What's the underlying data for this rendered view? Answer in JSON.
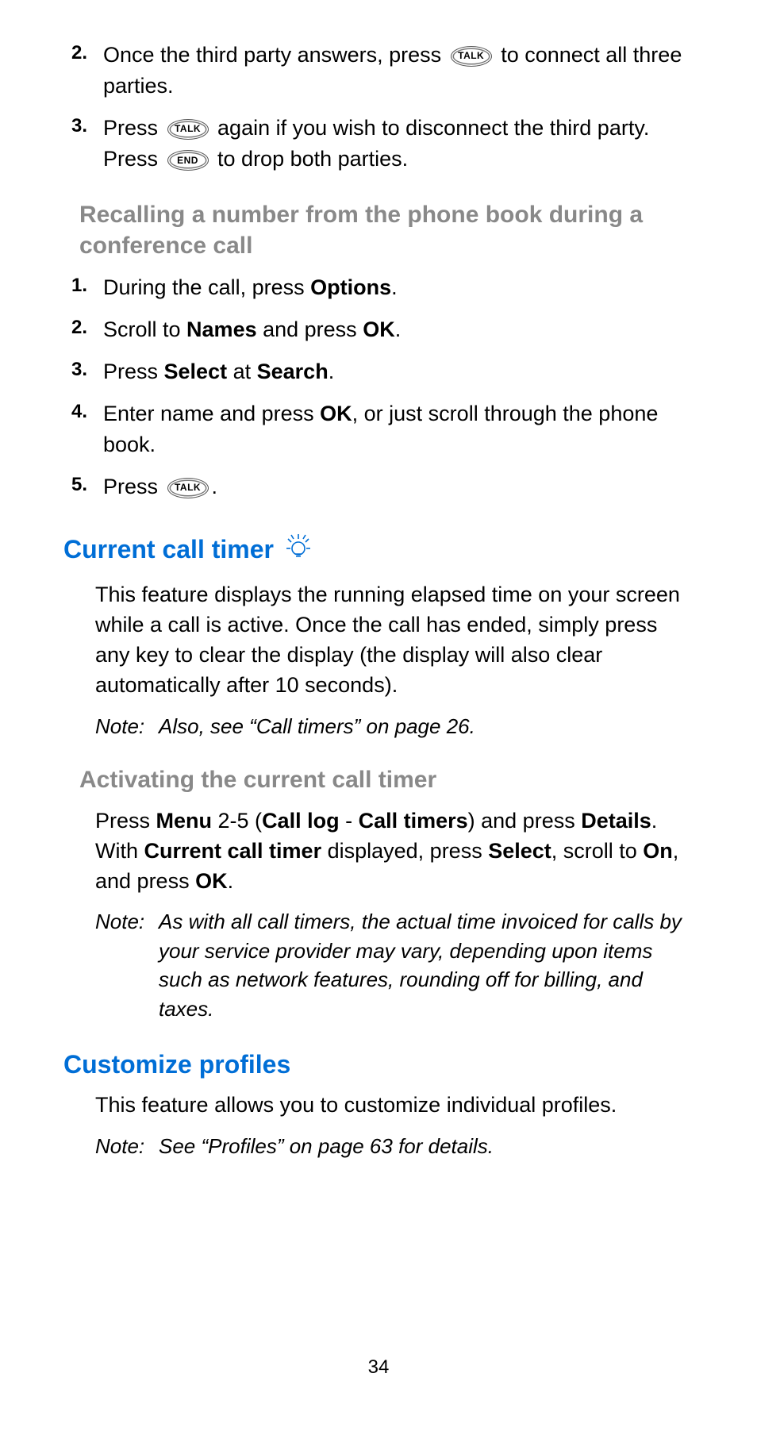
{
  "top_steps": [
    {
      "n": "2.",
      "pre": "Once the third party answers, press ",
      "key": "TALK",
      "post": " to connect all three parties."
    },
    {
      "n": "3.",
      "pre": "Press ",
      "key": "TALK",
      "mid": " again if you wish to disconnect the third party. Press ",
      "key2": "END",
      "post": " to drop both parties."
    }
  ],
  "recall": {
    "heading": "Recalling a number from the phone book during a conference call",
    "steps": {
      "s1": {
        "n": "1.",
        "a": "During the call, press ",
        "b1": "Options",
        "c": "."
      },
      "s2": {
        "n": "2.",
        "a": "Scroll to ",
        "b1": "Names",
        "c": " and press ",
        "b2": "OK",
        "d": "."
      },
      "s3": {
        "n": "3.",
        "a": "Press ",
        "b1": "Select",
        "c": " at ",
        "b2": "Search",
        "d": "."
      },
      "s4": {
        "n": "4.",
        "a": "Enter name and press ",
        "b1": "OK",
        "c": ", or just scroll through the phone book."
      },
      "s5": {
        "n": "5.",
        "a": "Press ",
        "key": "TALK",
        "c": "."
      }
    }
  },
  "timer": {
    "heading": "Current call timer",
    "body": "This feature displays the running elapsed time on your screen while a call is active. Once the call has ended, simply press any key to clear the display (the display will also clear automatically after 10 seconds).",
    "note_lbl": "Note:",
    "note_txt": "Also, see “Call timers” on page 26.",
    "sub": "Activating the current call timer",
    "act": {
      "a": "Press ",
      "b1": "Menu",
      "c": " 2-5 (",
      "b2": "Call log",
      "d": " - ",
      "b3": "Call timers",
      "e": ") and press ",
      "b4": "Details",
      "f": ". With ",
      "b5": "Current call timer",
      "g": " displayed, press ",
      "b6": "Select",
      "h": ", scroll to ",
      "b7": "On",
      "i": ", and press ",
      "b8": "OK",
      "j": "."
    },
    "note2_lbl": "Note:",
    "note2_txt": "As with all call timers, the actual time invoiced for calls by your service provider may vary, depending upon items such as network features, rounding off for billing, and taxes."
  },
  "profiles": {
    "heading": "Customize profiles",
    "body": "This feature allows you to customize individual profiles.",
    "note_lbl": "Note:",
    "note_txt": "See “Profiles” on page 63 for details."
  },
  "page": "34"
}
